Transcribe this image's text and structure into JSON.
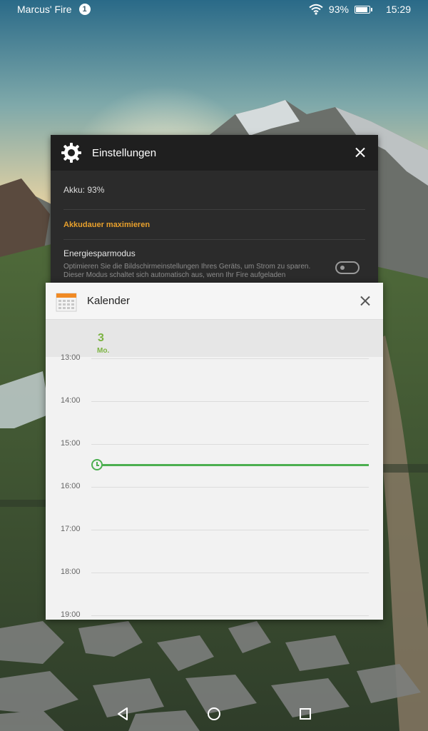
{
  "status_bar": {
    "device_name": "Marcus' Fire",
    "notification_count": "1",
    "battery": "93%",
    "battery_level": 0.93,
    "time": "15:29"
  },
  "settings_card": {
    "title": "Einstellungen",
    "battery_label": "Akku: 93%",
    "maximize_label": "Akkudauer maximieren",
    "energy_title": "Energiesparmodus",
    "energy_description": "Optimieren Sie die Bildschirmeinstellungen Ihres Geräts, um Strom zu sparen. Dieser Modus schaltet sich automatisch aus, wenn Ihr Fire aufgeladen",
    "energy_toggle_on": false
  },
  "calendar_card": {
    "title": "Kalender",
    "day_number": "3",
    "day_name": "Mo.",
    "hours": [
      "13:00",
      "14:00",
      "15:00",
      "16:00",
      "17:00",
      "18:00",
      "19:00"
    ],
    "current_time": "15:29",
    "accent_color": "#4caf50",
    "day_color": "#7cb342"
  },
  "nav_bar": {
    "back": "back-icon",
    "home": "home-icon",
    "recents": "recents-icon"
  }
}
